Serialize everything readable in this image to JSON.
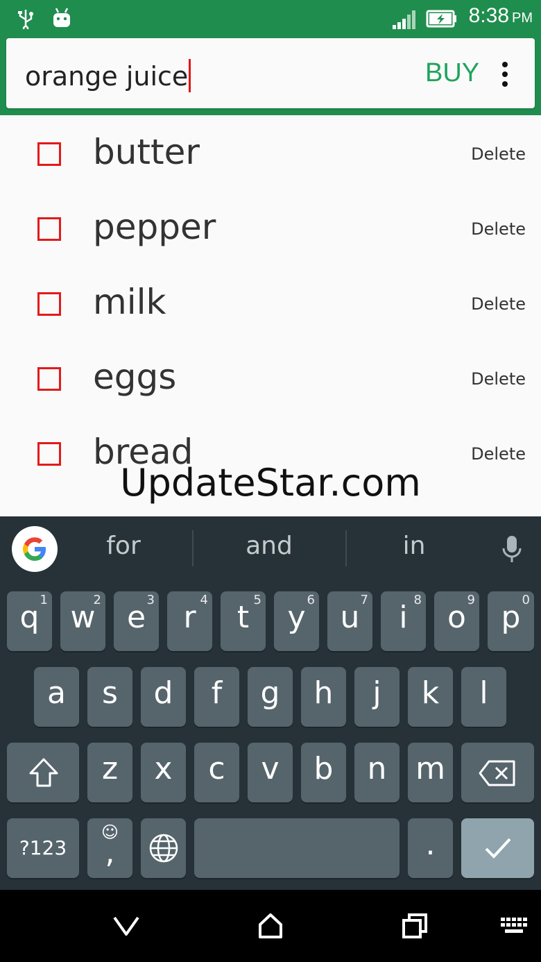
{
  "status_bar": {
    "time": "8:38",
    "ampm": "PM"
  },
  "input": {
    "value": "orange juice"
  },
  "buy_label": "BUY",
  "list": [
    {
      "name": "butter",
      "delete": "Delete"
    },
    {
      "name": "pepper",
      "delete": "Delete"
    },
    {
      "name": "milk",
      "delete": "Delete"
    },
    {
      "name": "eggs",
      "delete": "Delete"
    },
    {
      "name": "bread",
      "delete": "Delete"
    }
  ],
  "watermark": "UpdateStar.com",
  "keyboard": {
    "suggestions": [
      "for",
      "and",
      "in"
    ],
    "row1": [
      {
        "key": "q",
        "hint": "1"
      },
      {
        "key": "w",
        "hint": "2"
      },
      {
        "key": "e",
        "hint": "3"
      },
      {
        "key": "r",
        "hint": "4"
      },
      {
        "key": "t",
        "hint": "5"
      },
      {
        "key": "y",
        "hint": "6"
      },
      {
        "key": "u",
        "hint": "7"
      },
      {
        "key": "i",
        "hint": "8"
      },
      {
        "key": "o",
        "hint": "9"
      },
      {
        "key": "p",
        "hint": "0"
      }
    ],
    "row2": [
      "a",
      "s",
      "d",
      "f",
      "g",
      "h",
      "j",
      "k",
      "l"
    ],
    "row3": [
      "z",
      "x",
      "c",
      "v",
      "b",
      "n",
      "m"
    ],
    "symbols_label": "?123",
    "comma_label": ",",
    "period_label": ".",
    "emoji_hint": "☺"
  },
  "colors": {
    "accent": "#1f8d4e",
    "buy": "#1fa45c",
    "checkbox": "#e21a1a",
    "key": "#56656c",
    "keyboard_bg": "#263238"
  },
  "icons": [
    "usb-icon",
    "android-icon",
    "signal-icon",
    "battery-icon",
    "overflow-menu-icon",
    "google-icon",
    "mic-icon",
    "shift-icon",
    "backspace-icon",
    "globe-icon",
    "checkmark-icon",
    "back-icon",
    "home-icon",
    "recents-icon",
    "keyboard-icon"
  ]
}
